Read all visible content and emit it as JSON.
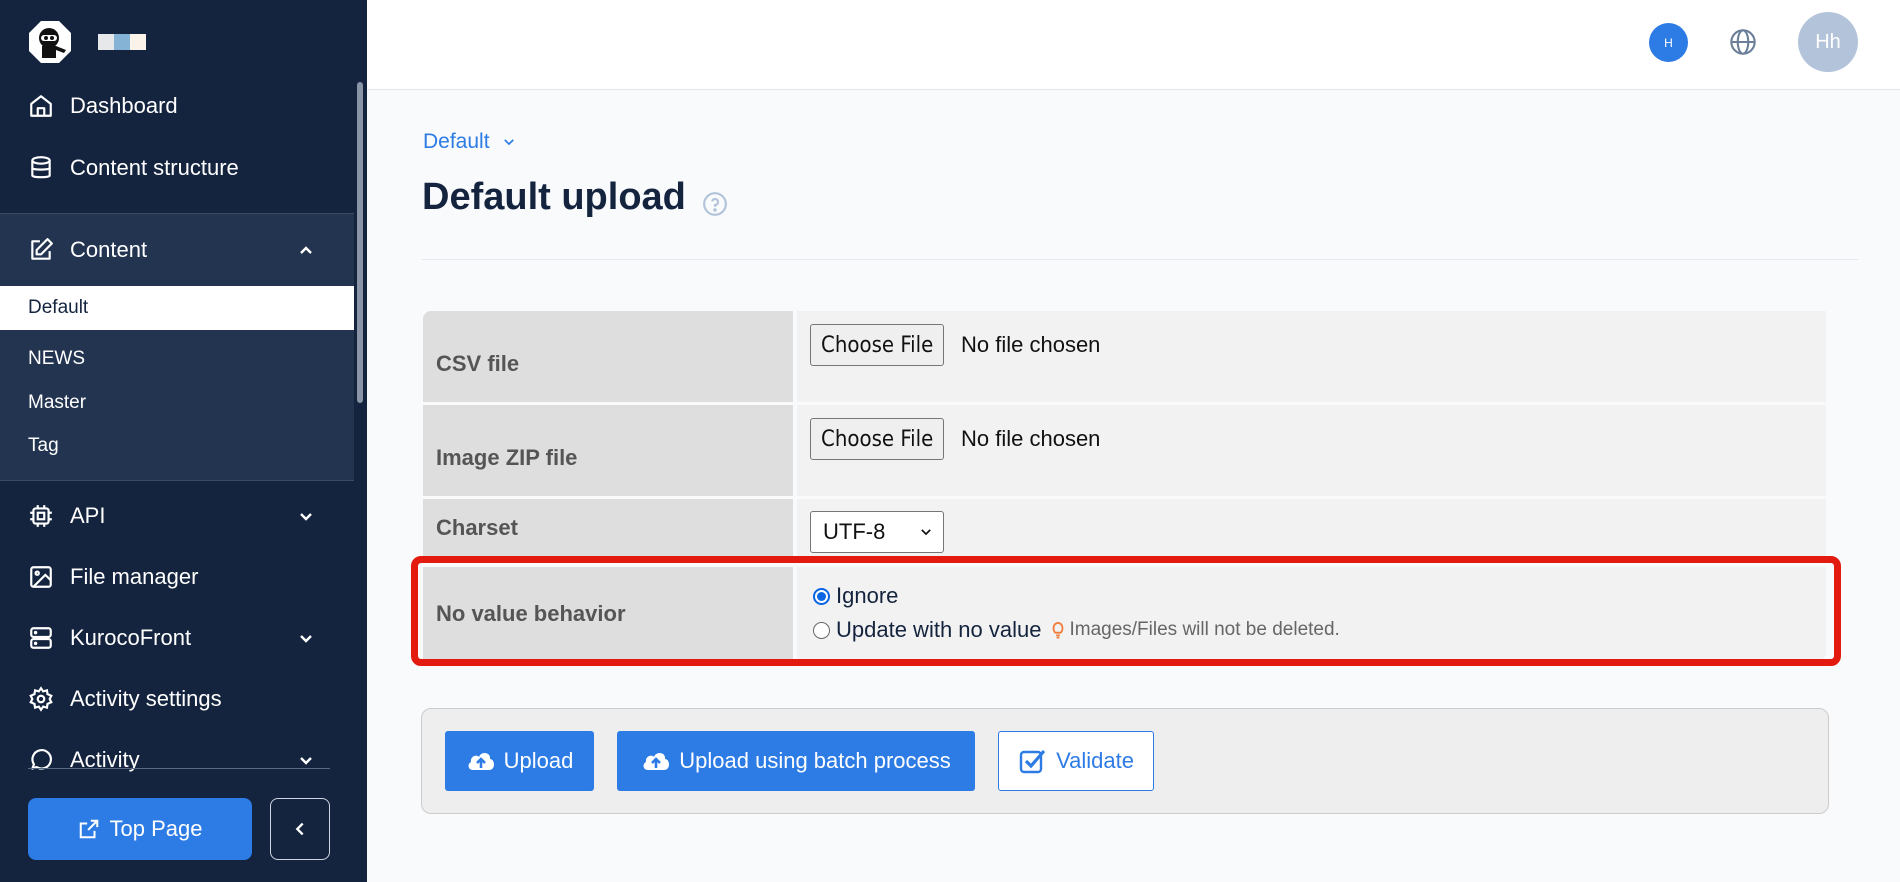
{
  "sidebar": {
    "brand_swatch_colors": [
      "#e6e8e9",
      "#84b3d6",
      "#fbf2ea"
    ],
    "items": [
      {
        "label": "Dashboard",
        "icon": "home-icon"
      },
      {
        "label": "Content structure",
        "icon": "database-icon"
      },
      {
        "label": "Content",
        "icon": "edit-icon",
        "expanded": true
      },
      {
        "label": "API",
        "icon": "chip-icon"
      },
      {
        "label": "File manager",
        "icon": "image-icon"
      },
      {
        "label": "KurocoFront",
        "icon": "server-icon"
      },
      {
        "label": "Activity settings",
        "icon": "gear-icon"
      },
      {
        "label": "Activity",
        "icon": "chat-icon"
      }
    ],
    "content_sub_items": [
      {
        "label": "Default",
        "active": true
      },
      {
        "label": "NEWS"
      },
      {
        "label": "Master"
      },
      {
        "label": "Tag"
      }
    ],
    "top_page_label": "Top Page"
  },
  "header": {
    "small_avatar_initial": "H",
    "user_avatar_initials": "Hh"
  },
  "main": {
    "breadcrumb": "Default",
    "title": "Default upload",
    "form": {
      "csv_label": "CSV file",
      "zip_label": "Image ZIP file",
      "charset_label": "Charset",
      "no_value_label": "No value behavior",
      "choose_file_label": "Choose File",
      "no_file_text": "No file chosen",
      "charset_value": "UTF-8",
      "radio_options": [
        {
          "label": "Ignore",
          "checked": true
        },
        {
          "label": "Update with no value",
          "checked": false
        }
      ],
      "hint": "Images/Files will not be deleted."
    },
    "buttons": {
      "upload": "Upload",
      "batch_upload": "Upload using batch process",
      "validate": "Validate"
    }
  },
  "colors": {
    "sidebar_bg": "#14243e",
    "accent": "#2d7be5",
    "highlight": "#e31a10"
  }
}
